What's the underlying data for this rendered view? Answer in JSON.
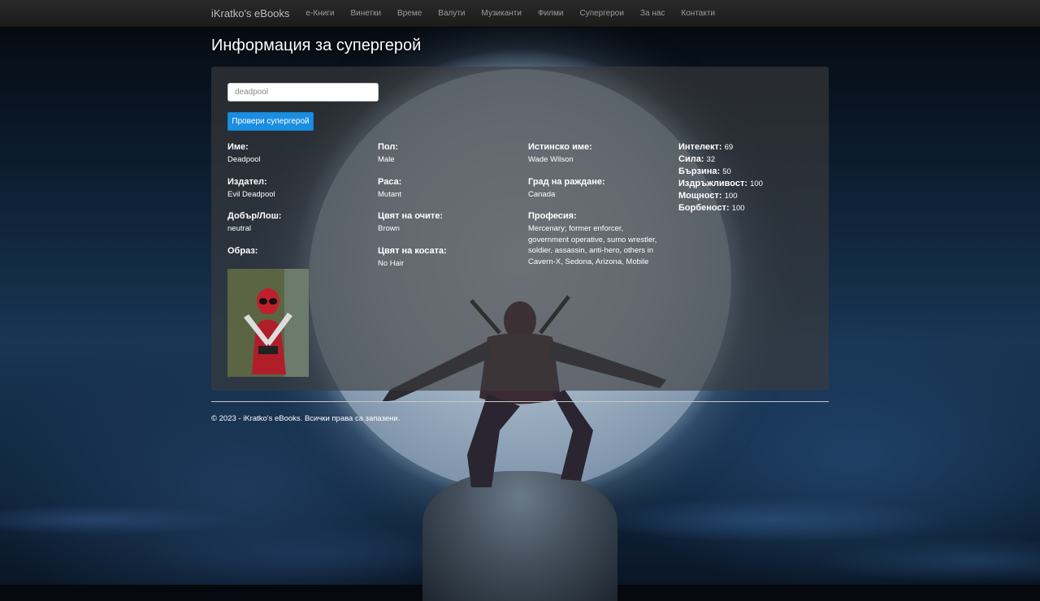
{
  "navbar": {
    "brand": "iKratko's eBooks",
    "links": [
      "е-Книги",
      "Винетки",
      "Време",
      "Валути",
      "Музиканти",
      "Филми",
      "Супергерои",
      "За нас",
      "Контакти"
    ]
  },
  "page": {
    "title": "Информация за супергерой"
  },
  "search": {
    "value": "deadpool",
    "button_label": "Провери супергерой"
  },
  "hero": {
    "col1": [
      {
        "label": "Име:",
        "value": "Deadpool"
      },
      {
        "label": "Издател:",
        "value": "Evil Deadpool"
      },
      {
        "label": "Добър/Лош:",
        "value": "neutral"
      }
    ],
    "image_label": "Образ:",
    "col2": [
      {
        "label": "Пол:",
        "value": "Male"
      },
      {
        "label": "Раса:",
        "value": "Mutant"
      },
      {
        "label": "Цвят на очите:",
        "value": "Brown"
      },
      {
        "label": "Цвят на косата:",
        "value": "No Hair"
      }
    ],
    "col3": [
      {
        "label": "Истинско име:",
        "value": "Wade Wilson"
      },
      {
        "label": "Град на раждане:",
        "value": "Canada"
      },
      {
        "label": "Професия:",
        "value": "Mercenary; former enforcer, government operative, sumo wrestler, soldier, assassin, anti-hero, others in Cavern-X, Sedona, Arizona, Mobile"
      }
    ],
    "stats": [
      {
        "label": "Интелект:",
        "value": "69"
      },
      {
        "label": "Сила:",
        "value": "32"
      },
      {
        "label": "Бързина:",
        "value": "50"
      },
      {
        "label": "Издръжливост:",
        "value": "100"
      },
      {
        "label": "Мощност:",
        "value": "100"
      },
      {
        "label": "Борбеност:",
        "value": "100"
      }
    ]
  },
  "footer": {
    "text": "© 2023 - iKratko's eBooks. Всички права са запазени."
  },
  "colors": {
    "button": "#1a8ee0",
    "navbar": "#222222",
    "card": "rgba(60,60,60,0.62)"
  }
}
